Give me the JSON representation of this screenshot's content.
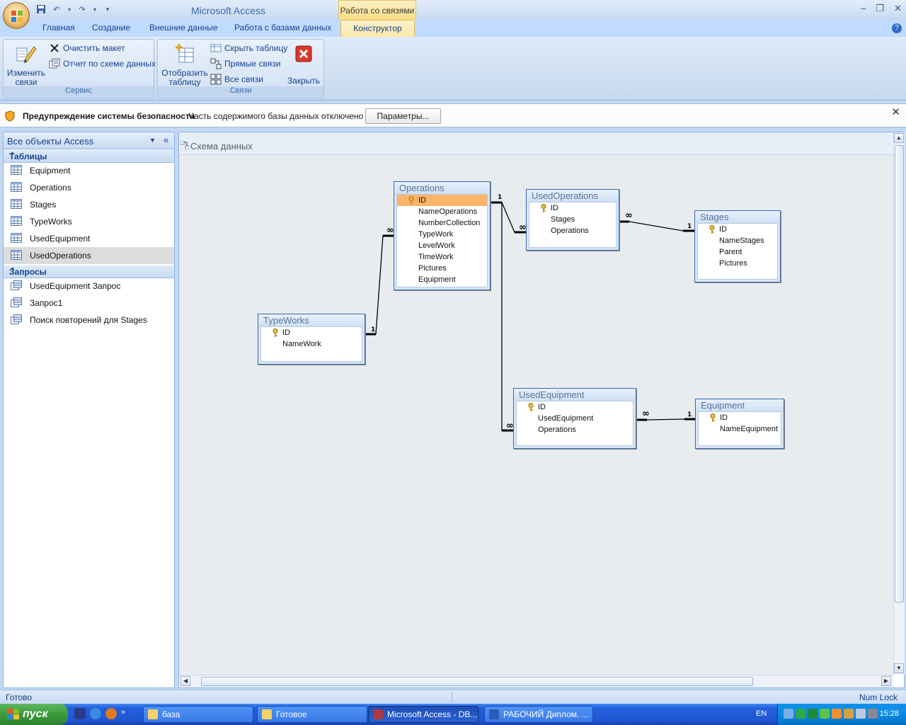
{
  "window": {
    "app_title": "Microsoft Access",
    "context_title": "Работа со связями"
  },
  "tabs": [
    "Главная",
    "Создание",
    "Внешние данные",
    "Работа с базами данных"
  ],
  "active_tab": "Конструктор",
  "ribbon": {
    "service_group": {
      "label": "Сервис",
      "edit_relations": "Изменить\nсвязи",
      "clear_layout": "Очистить макет",
      "relations_report": "Отчет по схеме данных"
    },
    "relations_group": {
      "label": "Связи",
      "show_table": "Отобразить\nтаблицу",
      "hide_table": "Скрыть таблицу",
      "direct_relations": "Прямые связи",
      "all_relations": "Все связи",
      "close": "Закрыть"
    }
  },
  "security": {
    "title": "Предупреждение системы безопасности",
    "message": "Часть содержимого базы данных отключено",
    "button": "Параметры..."
  },
  "nav": {
    "title": "Все объекты Access",
    "tables_label": "Таблицы",
    "tables": [
      "Equipment",
      "Operations",
      "Stages",
      "TypeWorks",
      "UsedEquipment",
      "UsedOperations"
    ],
    "selected_table": "UsedOperations",
    "queries_label": "Запросы",
    "queries": [
      "UsedEquipment Запрос",
      "Запрос1",
      "Поиск повторений для Stages"
    ]
  },
  "document": {
    "title": "Схема данных"
  },
  "diagram": {
    "tables": [
      {
        "name": "Operations",
        "fields": [
          "ID",
          "NameOperations",
          "NumberCollection",
          "TypeWork",
          "LevelWork",
          "TimeWork",
          "Pictures",
          "Equipment"
        ],
        "key": "ID",
        "highlighted": "ID"
      },
      {
        "name": "UsedOperations",
        "fields": [
          "ID",
          "Stages",
          "Operations"
        ],
        "key": "ID"
      },
      {
        "name": "Stages",
        "fields": [
          "ID",
          "NameStages",
          "Parent",
          "Pictures"
        ],
        "key": "ID"
      },
      {
        "name": "TypeWorks",
        "fields": [
          "ID",
          "NameWork"
        ],
        "key": "ID"
      },
      {
        "name": "UsedEquipment",
        "fields": [
          "ID",
          "UsedEquipment",
          "Operations"
        ],
        "key": "ID"
      },
      {
        "name": "Equipment",
        "fields": [
          "ID",
          "NameEquipment"
        ],
        "key": "ID"
      }
    ],
    "relations": [
      {
        "from": "Operations.ID",
        "to": "UsedOperations.Operations",
        "one": "1",
        "many": "∞"
      },
      {
        "from": "Stages.ID",
        "to": "UsedOperations.Stages",
        "one": "1",
        "many": "∞"
      },
      {
        "from": "TypeWorks.ID",
        "to": "Operations.TypeWork",
        "one": "1",
        "many": "∞"
      },
      {
        "from": "Operations.ID",
        "to": "UsedEquipment.Operations",
        "one": "1",
        "many": "∞"
      },
      {
        "from": "Equipment.ID",
        "to": "UsedEquipment.UsedEquipment",
        "one": "1",
        "many": "∞"
      }
    ]
  },
  "status": {
    "left": "Готово",
    "right": "Num Lock"
  },
  "taskbar": {
    "start": "пуск",
    "tasks": [
      "база",
      "Готовое",
      "Microsoft Access - DB...",
      "РАБОЧИЙ Диплом. ..."
    ],
    "active_task": "Microsoft Access - DB...",
    "lang": "EN",
    "clock": "15:28"
  }
}
